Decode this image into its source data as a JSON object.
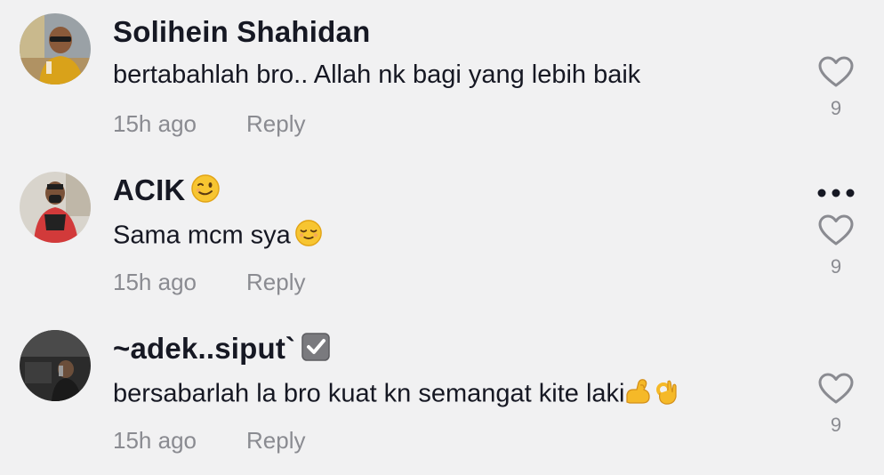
{
  "comments": [
    {
      "username": "Solihein Shahidan",
      "text": "bertabahlah bro.. Allah nk bagi yang lebih baik",
      "time": "15h ago",
      "reply_label": "Reply",
      "like_count": "9",
      "icons": [
        "heart-icon"
      ]
    },
    {
      "username": "ACIK",
      "username_emoji": "winking-face-emoji",
      "text": "Sama mcm sya",
      "text_emoji": "relieved-face-emoji",
      "time": "15h ago",
      "reply_label": "Reply",
      "like_count": "9",
      "icons": [
        "heart-icon",
        "more-options-icon"
      ]
    },
    {
      "username": "~adek..siput`",
      "username_emoji": "check-box-emoji",
      "text": "bersabarlah la bro kuat kn semangat kite laki",
      "text_emoji": "flexed-biceps-ok-hand-emoji",
      "time": "15h ago",
      "reply_label": "Reply",
      "like_count": "9",
      "icons": [
        "heart-icon"
      ]
    }
  ],
  "colors": {
    "background": "#f1f1f2",
    "primary_text": "#161823",
    "secondary_text": "#8a8b91"
  }
}
